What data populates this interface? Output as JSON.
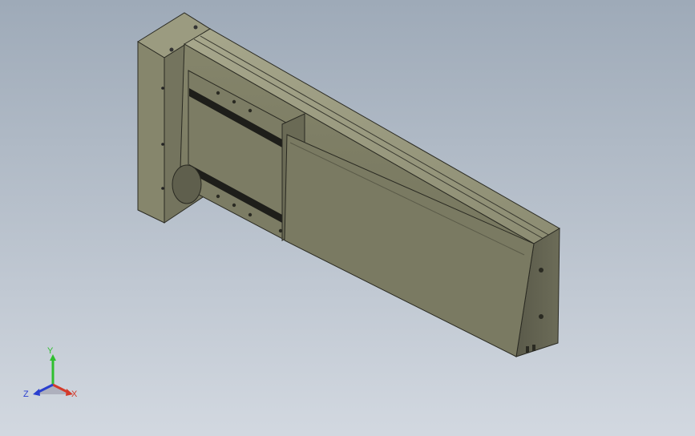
{
  "viewport": {
    "background_top": "#9eaab8",
    "background_bottom": "#d2d8e0",
    "model_color": "#8a8a70",
    "model_edge_color": "#2a2a22"
  },
  "triad": {
    "x_label": "X",
    "y_label": "Y",
    "z_label": "Z",
    "x_color": "#d43a2a",
    "y_color": "#2fbf2f",
    "z_color": "#2a3fcf"
  }
}
